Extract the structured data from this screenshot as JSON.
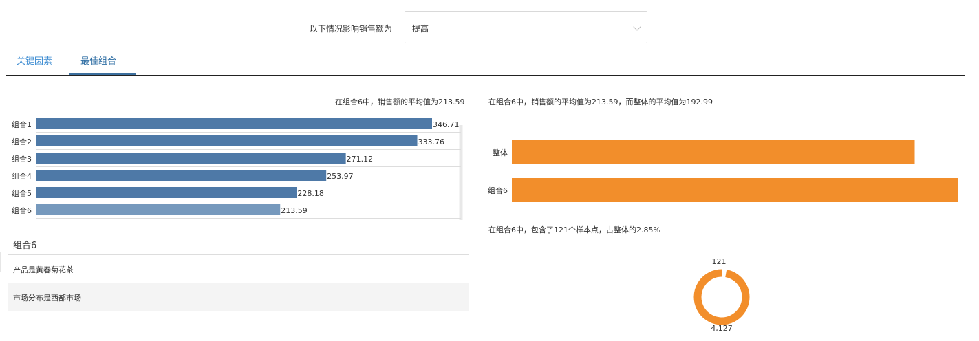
{
  "filter": {
    "label": "以下情况影响销售额为",
    "value": "提高"
  },
  "tabs": [
    {
      "label": "关键因素"
    },
    {
      "label": "最佳组合"
    }
  ],
  "bar_chart_title": "在组合6中，销售额的平均值为213.59",
  "compare_title": "在组合6中，销售额的平均值为213.59，而整体的平均值为192.99",
  "donut_title": "在组合6中，包含了121个样本点，占整体的2.85%",
  "detail": {
    "heading": "组合6",
    "rows": [
      "产品是黄春菊花茶",
      "市场分布是西部市场"
    ]
  },
  "chart_data": [
    {
      "type": "bar",
      "orientation": "horizontal",
      "categories": [
        "组合1",
        "组合2",
        "组合3",
        "组合4",
        "组合5",
        "组合6"
      ],
      "values": [
        346.71,
        333.76,
        271.12,
        253.97,
        228.18,
        213.59
      ],
      "value_labels": [
        "346.71",
        "333.76",
        "271.12",
        "253.97",
        "228.18",
        "213.59"
      ],
      "highlight": "组合6",
      "colors": {
        "bar": "#4e79a7",
        "highlight": "#7699bd"
      }
    },
    {
      "type": "bar",
      "orientation": "horizontal",
      "categories": [
        "整体",
        "组合6"
      ],
      "values": [
        192.99,
        213.59
      ],
      "colors": {
        "bar": "#f28e2b"
      }
    },
    {
      "type": "pie",
      "variant": "donut",
      "labels": [
        "121",
        "4,127"
      ],
      "values": [
        121,
        4127
      ],
      "colors": {
        "highlight": "#ffffff",
        "rest": "#f28e2b"
      }
    }
  ]
}
